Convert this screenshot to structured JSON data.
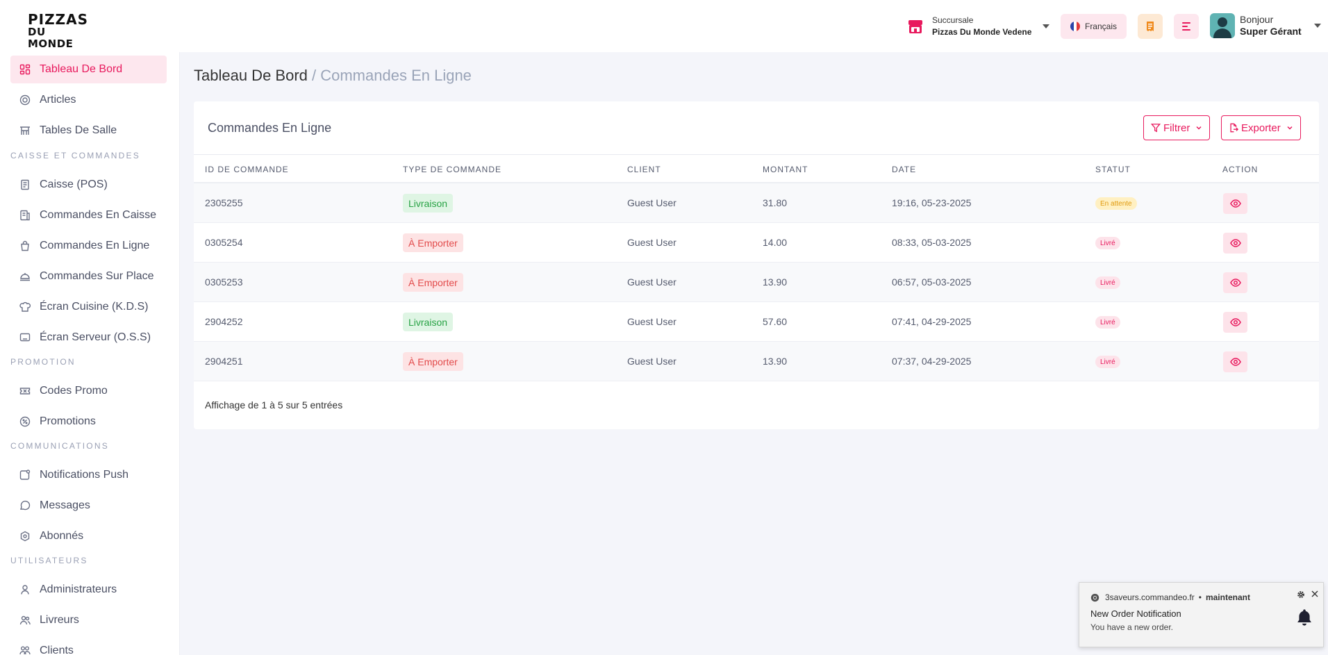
{
  "header": {
    "logo_line1": "PIZZAS",
    "logo_line2": "DU MONDE",
    "branch_label": "Succursale",
    "branch_name": "Pizzas Du Monde Vedene",
    "language": "Français",
    "greeting": "Bonjour",
    "user_name": "Super Gérant"
  },
  "sidebar": {
    "items": [
      {
        "label": "Tableau De Bord",
        "icon": "dashboard-icon",
        "active": true
      },
      {
        "label": "Articles",
        "icon": "articles-icon"
      },
      {
        "label": "Tables De Salle",
        "icon": "tables-icon"
      },
      {
        "label": "Caisse (POS)",
        "icon": "pos-icon"
      },
      {
        "label": "Commandes En Caisse",
        "icon": "pos-orders-icon"
      },
      {
        "label": "Commandes En Ligne",
        "icon": "online-orders-icon"
      },
      {
        "label": "Commandes Sur Place",
        "icon": "dine-in-icon"
      },
      {
        "label": "Écran Cuisine (K.D.S)",
        "icon": "kitchen-icon"
      },
      {
        "label": "Écran Serveur (O.S.S)",
        "icon": "server-screen-icon"
      },
      {
        "label": "Codes Promo",
        "icon": "ticket-icon"
      },
      {
        "label": "Promotions",
        "icon": "promo-icon"
      },
      {
        "label": "Notifications Push",
        "icon": "push-icon"
      },
      {
        "label": "Messages",
        "icon": "messages-icon"
      },
      {
        "label": "Abonnés",
        "icon": "subscribers-icon"
      },
      {
        "label": "Administrateurs",
        "icon": "admin-icon"
      },
      {
        "label": "Livreurs",
        "icon": "drivers-icon"
      },
      {
        "label": "Clients",
        "icon": "clients-icon"
      }
    ],
    "sections": {
      "caisse": "CAISSE ET COMMANDES",
      "promotion": "PROMOTION",
      "communications": "COMMUNICATIONS",
      "utilisateurs": "UTILISATEURS"
    }
  },
  "breadcrumb": {
    "root": "Tableau De Bord",
    "separator": " / ",
    "current": "Commandes En Ligne"
  },
  "card": {
    "title": "Commandes En Ligne",
    "filter_label": "Filtrer",
    "export_label": "Exporter",
    "columns": [
      "ID DE COMMANDE",
      "TYPE DE COMMANDE",
      "CLIENT",
      "MONTANT",
      "DATE",
      "STATUT",
      "ACTION"
    ],
    "rows": [
      {
        "id": "2305255",
        "type": "Livraison",
        "client": "Guest User",
        "amount": "31.80",
        "date": "19:16, 05-23-2025",
        "status": "En attente"
      },
      {
        "id": "0305254",
        "type": "À Emporter",
        "client": "Guest User",
        "amount": "14.00",
        "date": "08:33, 05-03-2025",
        "status": "Livré"
      },
      {
        "id": "0305253",
        "type": "À Emporter",
        "client": "Guest User",
        "amount": "13.90",
        "date": "06:57, 05-03-2025",
        "status": "Livré"
      },
      {
        "id": "2904252",
        "type": "Livraison",
        "client": "Guest User",
        "amount": "57.60",
        "date": "07:41, 04-29-2025",
        "status": "Livré"
      },
      {
        "id": "2904251",
        "type": "À Emporter",
        "client": "Guest User",
        "amount": "13.90",
        "date": "07:37, 04-29-2025",
        "status": "Livré"
      }
    ],
    "footer_info": "Affichage de 1 à 5 sur 5 entrées"
  },
  "notification": {
    "source": "3saveurs.commandeo.fr",
    "dot": "•",
    "time": "maintenant",
    "title": "New Order Notification",
    "body": "You have a new order."
  },
  "colors": {
    "accent": "#e8195d",
    "accent_light": "#fde7ee",
    "livraison_bg": "#dff5e4",
    "livraison_text": "#27a244",
    "emporter_bg": "#fde3e4",
    "emporter_text": "#e24b4b",
    "pending_bg": "#fff0c2",
    "pending_text": "#e09a0f"
  }
}
